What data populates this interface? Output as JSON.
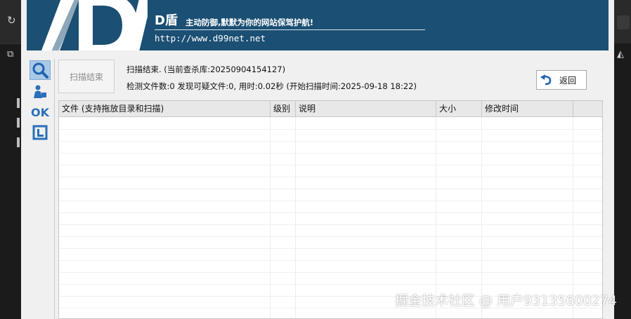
{
  "app": {
    "brand": "D盾",
    "slogan": "主动防御,默默为你的网站保驾护航!",
    "url": "http://www.d99net.net"
  },
  "sidebar": {
    "items": [
      {
        "name": "scan",
        "icon": "magnifier-icon",
        "active": true
      },
      {
        "name": "user",
        "icon": "user-tool-icon",
        "active": false
      },
      {
        "name": "ok",
        "label": "OK",
        "icon": "ok-icon",
        "active": false
      },
      {
        "name": "window",
        "icon": "window-icon",
        "active": false
      }
    ]
  },
  "scan_panel": {
    "scan_button_label": "扫描结束",
    "status_line1": "扫描结束. (当前查杀库:20250904154127)",
    "status_line2": "检测文件数:0 发现可疑文件:0, 用时:0.02秒 (开始扫描时间:2025-09-18 18:22)",
    "back_button_label": "返回"
  },
  "table": {
    "columns": [
      "文件 (支持拖放目录和扫描)",
      "级别",
      "说明",
      "大小",
      "修改时间"
    ],
    "rows": []
  },
  "watermark": "掘金技术社区 @ 用户93135600274",
  "colors": {
    "banner": "#1b4f73",
    "dialog_bg": "#f0f0f0",
    "sidebar_icon": "#2a6fb8",
    "active_item": "#aac9e6"
  }
}
